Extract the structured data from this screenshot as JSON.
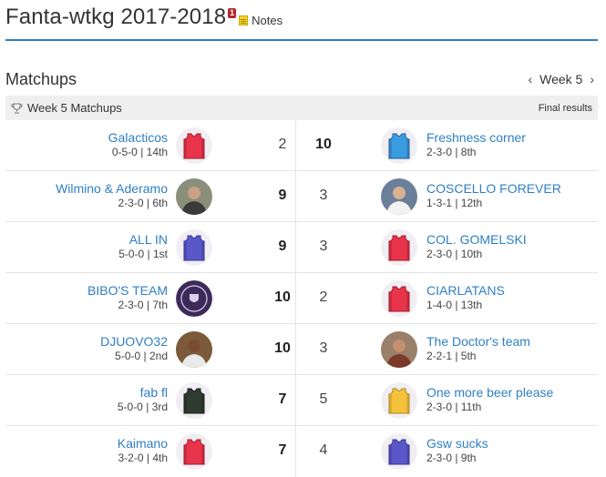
{
  "league": {
    "title": "Fanta-wtkg 2017-2018",
    "badge": "1",
    "notes_label": "Notes"
  },
  "section": {
    "title": "Matchups",
    "week_label": "Week 5"
  },
  "subheader": {
    "label": "Week 5 Matchups",
    "status": "Final results"
  },
  "matchups": [
    {
      "home": {
        "name": "Galacticos",
        "record": "0-5-0 | 14th",
        "avatar": "jersey-red",
        "score": "2"
      },
      "away": {
        "name": "Freshness corner",
        "record": "2-3-0 | 8th",
        "avatar": "jersey-blue",
        "score": "10"
      }
    },
    {
      "home": {
        "name": "Wilmino & Aderamo",
        "record": "2-3-0 | 6th",
        "avatar": "photo",
        "score": "9"
      },
      "away": {
        "name": "COSCELLO FOREVER",
        "record": "1-3-1 | 12th",
        "avatar": "photo",
        "score": "3"
      }
    },
    {
      "home": {
        "name": "ALL IN",
        "record": "5-0-0 | 1st",
        "avatar": "jersey-purple",
        "score": "9"
      },
      "away": {
        "name": "COL. GOMELSKI",
        "record": "2-3-0 | 10th",
        "avatar": "jersey-red",
        "score": "3"
      }
    },
    {
      "home": {
        "name": "BIBO'S TEAM",
        "record": "2-3-0 | 7th",
        "avatar": "logo",
        "score": "10"
      },
      "away": {
        "name": "CIARLATANS",
        "record": "1-4-0 | 13th",
        "avatar": "jersey-red",
        "score": "2"
      }
    },
    {
      "home": {
        "name": "DJUOVO32",
        "record": "5-0-0 | 2nd",
        "avatar": "photo",
        "score": "10"
      },
      "away": {
        "name": "The Doctor's team",
        "record": "2-2-1 | 5th",
        "avatar": "photo",
        "score": "3"
      }
    },
    {
      "home": {
        "name": "fab fl",
        "record": "5-0-0 | 3rd",
        "avatar": "jersey-dark",
        "score": "7"
      },
      "away": {
        "name": "One more beer please",
        "record": "2-3-0 | 11th",
        "avatar": "jersey-yellow",
        "score": "5"
      }
    },
    {
      "home": {
        "name": "Kaimano",
        "record": "3-2-0 | 4th",
        "avatar": "jersey-red",
        "score": "7"
      },
      "away": {
        "name": "Gsw sucks",
        "record": "2-3-0 | 9th",
        "avatar": "jersey-purple",
        "score": "4"
      }
    }
  ],
  "colors": {
    "accent": "#2f7fc4",
    "badge": "#b3262b",
    "subheader_bg": "#efefef"
  }
}
